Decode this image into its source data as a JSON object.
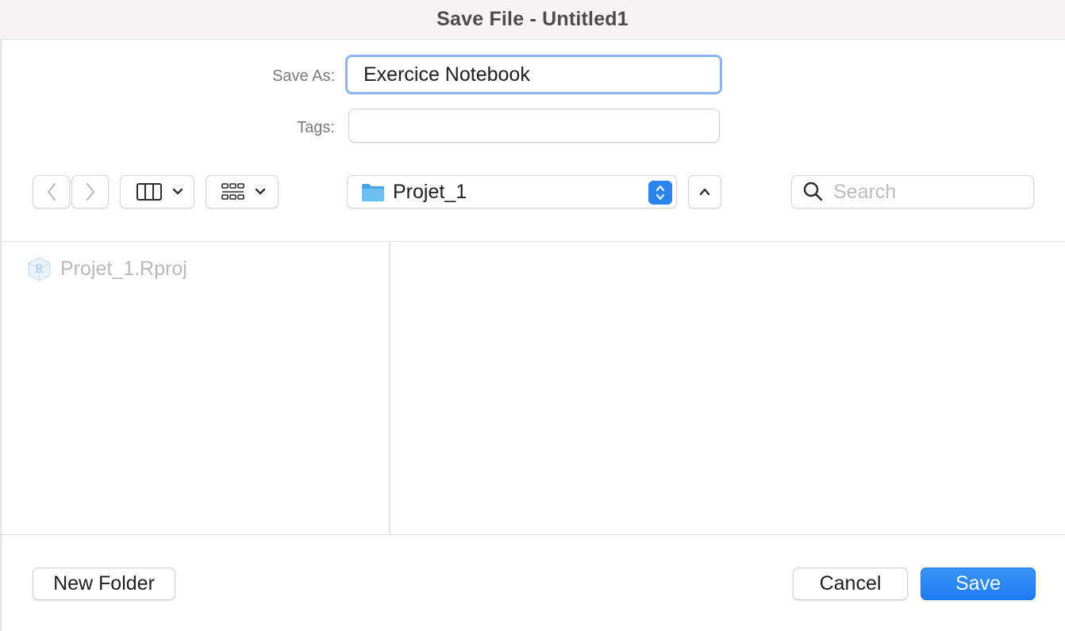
{
  "window": {
    "title": "Save File - Untitled1"
  },
  "save_as": {
    "label": "Save As:",
    "value": "Exercice Notebook"
  },
  "tags": {
    "label": "Tags:",
    "value": ""
  },
  "toolbar": {
    "back_icon": "chevron-left-icon",
    "forward_icon": "chevron-right-icon",
    "column_view_icon": "columns-icon",
    "group_icon": "grid-icon",
    "location": "Projet_1",
    "location_icon": "folder-icon",
    "up_icon": "chevron-up-icon"
  },
  "search": {
    "placeholder": "Search"
  },
  "files": [
    {
      "name": "Projet_1.Rproj",
      "icon": "rproj-file-icon",
      "enabled": false
    }
  ],
  "footer": {
    "new_folder_label": "New Folder",
    "cancel_label": "Cancel",
    "save_label": "Save"
  },
  "colors": {
    "accent": "#1f7cf3",
    "focus_ring": "#8fb5ee",
    "folder": "#5ab0ea"
  }
}
